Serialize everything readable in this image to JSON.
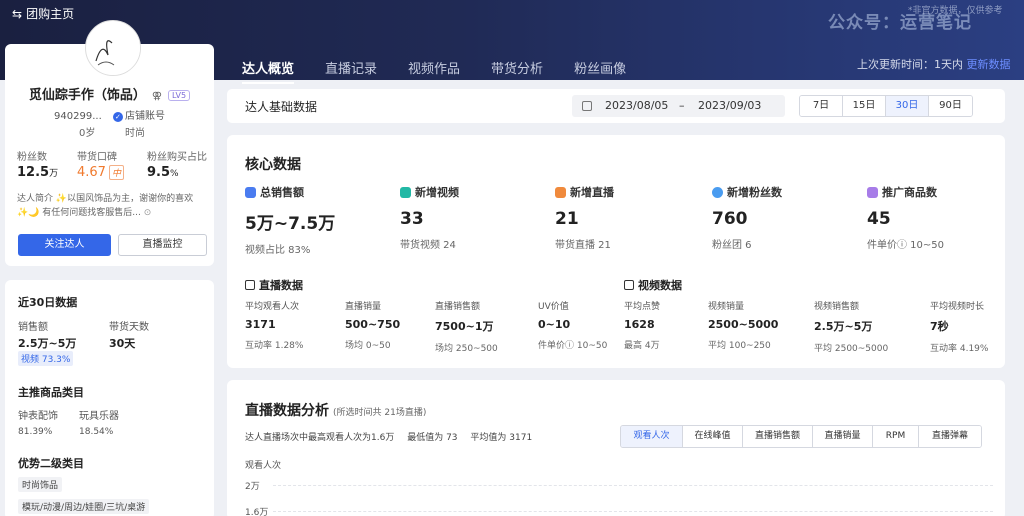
{
  "header": {
    "back_label": "团购主页",
    "watermark": "公众号：运营笔记",
    "watermark_note": "*非官方数据，仅供参考",
    "tabs": [
      {
        "label": "达人概览"
      },
      {
        "label": "直播记录"
      },
      {
        "label": "视频作品"
      },
      {
        "label": "带货分析"
      },
      {
        "label": "粉丝画像"
      }
    ],
    "update_text": "上次更新时间：1天内",
    "update_link": "更新数据"
  },
  "profile": {
    "avatar_text": "觅仙踪",
    "name": "觅仙踪手作（饰品）",
    "level": "LV5",
    "id": "940299...",
    "shop_label": "店铺账号",
    "age": "0岁",
    "category": "时尚",
    "fans_label": "粉丝数",
    "fans_value": "12.5",
    "fans_unit": "万",
    "reputation_label": "带货口碑",
    "reputation_value": "4.67",
    "reputation_tag": "中",
    "fan_buy_label": "粉丝购买占比",
    "fan_buy_value": "9.5",
    "fan_buy_unit": "%",
    "intro_line1": "达人简介 ✨以国风饰品为主，谢谢你的喜欢",
    "intro_line2": "✨🌙 有任何问题找客服售后...",
    "follow_button": "关注达人",
    "monitor_button": "直播监控"
  },
  "last30": {
    "title": "近30日数据",
    "sales_label": "销售额",
    "sales_value": "2.5万~5万",
    "days_label": "带货天数",
    "days_value": "30天",
    "video_pill": "视频 73.3%",
    "main_cat_title": "主推商品类目",
    "cat1": "钟表配饰",
    "cat1_pct": "81.39%",
    "cat2": "玩具乐器",
    "cat2_pct": "18.54%",
    "sub_cat_title": "优势二级类目",
    "chip1": "时尚饰品",
    "chip2": "模玩/动漫/周边/娃圈/三坑/桌游"
  },
  "filter": {
    "title": "达人基础数据",
    "start": "2023/08/05",
    "sep": "–",
    "end": "2023/09/03",
    "ranges": [
      "7日",
      "15日",
      "30日",
      "90日"
    ],
    "active_range": "30日"
  },
  "core": {
    "title": "核心数据",
    "metrics": [
      {
        "label": "总销售额",
        "value": "5万~7.5万",
        "sub": "视频占比 83%",
        "icon": "sales-icon",
        "color": "#4a7cf0"
      },
      {
        "label": "新增视频",
        "value": "33",
        "sub": "带货视频 24",
        "icon": "video-icon",
        "color": "#22b8a5"
      },
      {
        "label": "新增直播",
        "value": "21",
        "sub": "带货直播 21",
        "icon": "live-icon",
        "color": "#f08a3c"
      },
      {
        "label": "新增粉丝数",
        "value": "760",
        "sub": "粉丝团 6",
        "icon": "fans-icon",
        "color": "#4a9cf0"
      },
      {
        "label": "推广商品数",
        "value": "45",
        "sub": "件单价ⓘ 10~50",
        "icon": "goods-icon",
        "color": "#a77ce8"
      }
    ],
    "live_title": "直播数据",
    "video_title": "视频数据",
    "live_cells": [
      {
        "label": "平均观看人次",
        "value": "3171",
        "sub": "互动率 1.28%"
      },
      {
        "label": "直播销量",
        "value": "500~750",
        "sub": "场均 0~50"
      },
      {
        "label": "直播销售额",
        "value": "7500~1万",
        "sub": "场均 250~500"
      },
      {
        "label": "UV价值",
        "value": "0~10",
        "sub": "件单价ⓘ 10~50"
      }
    ],
    "video_cells": [
      {
        "label": "平均点赞",
        "value": "1628",
        "sub": "最高 4万"
      },
      {
        "label": "视频销量",
        "value": "2500~5000",
        "sub": "平均 100~250"
      },
      {
        "label": "视频销售额",
        "value": "2.5万~5万",
        "sub": "平均 2500~5000"
      },
      {
        "label": "平均视频时长",
        "value": "7秒",
        "sub": "互动率 4.19%"
      }
    ]
  },
  "live_analysis": {
    "title": "直播数据分析",
    "title_note": "(所选时间共 21场直播)",
    "summary_max": "达人直播场次中最高观看人次为1.6万",
    "summary_min": "最低值为 73",
    "summary_avg": "平均值为 3171",
    "segments": [
      "观看人次",
      "在线峰值",
      "直播销售额",
      "直播销量",
      "RPM",
      "直播弹幕"
    ],
    "active_segment": "观看人次",
    "y_label": "观看人次",
    "y_ticks": [
      "2万",
      "1.6万"
    ]
  }
}
